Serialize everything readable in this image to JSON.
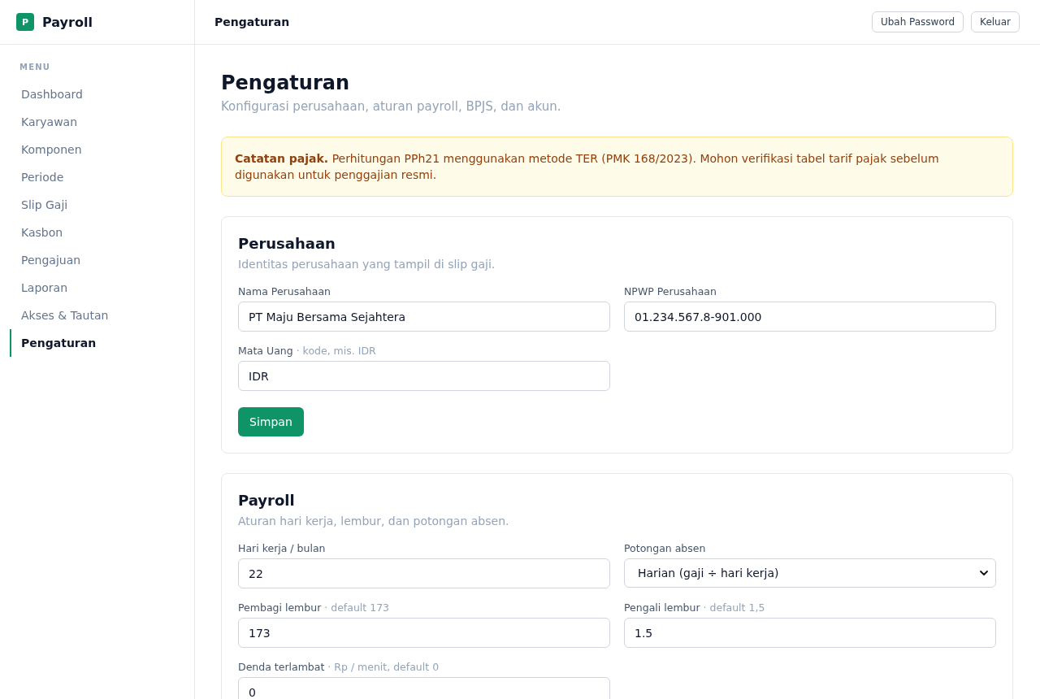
{
  "app": {
    "logo_letter": "P",
    "name": "Payroll"
  },
  "sidebar": {
    "heading": "MENU",
    "items": [
      {
        "label": "Dashboard",
        "selected": false
      },
      {
        "label": "Karyawan",
        "selected": false
      },
      {
        "label": "Komponen",
        "selected": false
      },
      {
        "label": "Periode",
        "selected": false
      },
      {
        "label": "Slip Gaji",
        "selected": false
      },
      {
        "label": "Kasbon",
        "selected": false
      },
      {
        "label": "Pengajuan",
        "selected": false
      },
      {
        "label": "Laporan",
        "selected": false
      },
      {
        "label": "Akses & Tautan",
        "selected": false
      },
      {
        "label": "Pengaturan",
        "selected": true
      }
    ]
  },
  "topbar": {
    "title": "Pengaturan",
    "buttons": [
      "Ubah Password",
      "Keluar"
    ]
  },
  "page": {
    "title": "Pengaturan",
    "subtitle": "Konfigurasi perusahaan, aturan payroll, BPJS, dan akun."
  },
  "notice": {
    "text": "**Catatan pajak.** Perhitungan PPh21 menggunakan metode TER (PMK 168/2023). Mohon verifikasi tabel tarif pajak sebelum digunakan untuk penggajian resmi."
  },
  "sections": [
    {
      "title": "Perusahaan",
      "subtitle": "Identitas perusahaan yang tampil di slip gaji.",
      "fields": [
        {
          "kind": "text",
          "label": "Nama Perusahaan",
          "value": "PT Maju Bersama Sejahtera"
        },
        {
          "kind": "text",
          "label": "NPWP Perusahaan",
          "value": "01.234.567.8-901.000"
        },
        {
          "kind": "text",
          "label": "Mata Uang",
          "hint": "· kode, mis. IDR",
          "value": "IDR"
        }
      ],
      "button": "Simpan"
    },
    {
      "title": "Payroll",
      "subtitle": "Aturan hari kerja, lembur, dan potongan absen.",
      "fields": [
        {
          "kind": "text",
          "label": "Hari kerja / bulan",
          "value": "22"
        },
        {
          "kind": "select",
          "label": "Potongan absen",
          "value": "Harian (gaji ÷ hari kerja)"
        },
        {
          "kind": "text",
          "label": "Pembagi lembur",
          "hint": "· default 173",
          "value": "173"
        },
        {
          "kind": "text",
          "label": "Pengali lembur",
          "hint": "· default 1,5",
          "value": "1.5"
        },
        {
          "kind": "text",
          "label": "Denda terlambat",
          "hint": "· Rp / menit, default 0",
          "value": "0"
        }
      ]
    }
  ]
}
